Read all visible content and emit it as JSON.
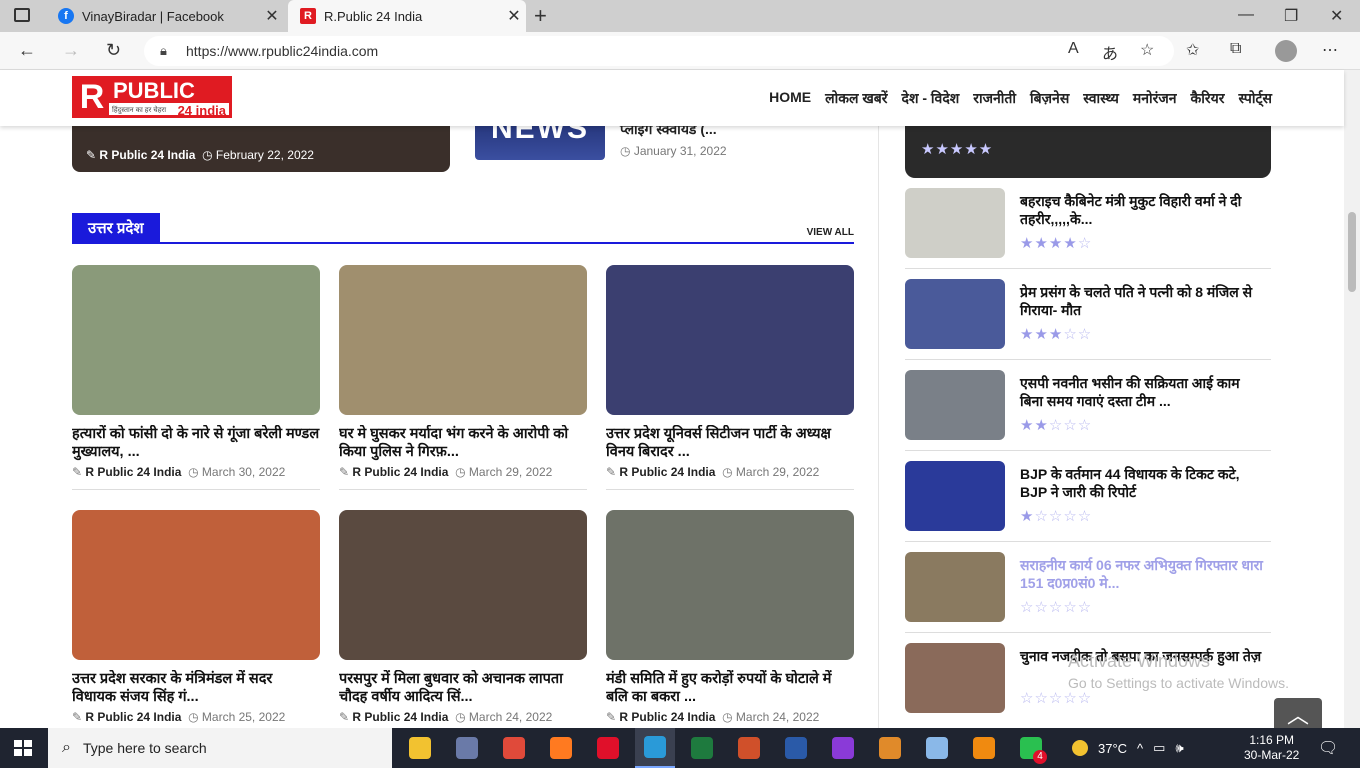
{
  "browser": {
    "tabs": [
      {
        "title": "VinayBiradar | Facebook",
        "icon": "facebook-icon",
        "color": "#1877f2"
      },
      {
        "title": "R.Public 24 India",
        "icon": "rpublic-icon",
        "color": "#e01b22"
      }
    ],
    "url": "https://www.rpublic24india.com"
  },
  "site": {
    "logo": {
      "letter": "R",
      "word": "PUBLIC",
      "tagline": "हिंदुस्तान का हर चेहरा",
      "suffix": "24 india"
    },
    "menu": [
      "HOME",
      "लोकल खबरें",
      "देश - विदेश",
      "राजनीती",
      "बिज़नेस",
      "स्वास्थ्य",
      "मनोरंजन",
      "कैरियर",
      "स्पोर्ट्स"
    ]
  },
  "top_row": {
    "left_author": "R Public 24 India",
    "left_date": "February 22, 2022",
    "thumb_text": "NEWS",
    "right_title": "प्लाइंग स्क्वायड (...",
    "right_date": "January 31, 2022"
  },
  "section": {
    "label": "उत्तर प्रदेश",
    "view_all": "VIEW ALL"
  },
  "cards": [
    {
      "title": "हत्यारों को फांसी दो के नारे से गूंजा बरेली मण्डल मुख्यालय, ...",
      "author": "R Public 24 India",
      "date": "March 30, 2022",
      "color": "#8a9a7a"
    },
    {
      "title": "घर मे घुसकर मर्यादा भंग करने के आरोपी को किया पुलिस ने गिरफ़...",
      "author": "R Public 24 India",
      "date": "March 29, 2022",
      "color": "#a08f6e"
    },
    {
      "title": "उत्तर प्रदेश यूनिवर्स सिटीजन पार्टी के अध्यक्ष विनय बिरादर ...",
      "author": "R Public 24 India",
      "date": "March 29, 2022",
      "color": "#3b3f70"
    },
    {
      "title": "उत्तर प्रदेश सरकार के मंत्रिमंडल में सदर विधायक संजय सिंह गं...",
      "author": "R Public 24 India",
      "date": "March 25, 2022",
      "color": "#c0603a"
    },
    {
      "title": "परसपुर में मिला बुधवार को अचानक लापता चौदह वर्षीय आदित्य सिं...",
      "author": "R Public 24 India",
      "date": "March 24, 2022",
      "color": "#5a4a40"
    },
    {
      "title": "मंडी समिति में हुए करोड़ों रुपयों के घोटाले में बलि का बकरा ...",
      "author": "R Public 24 India",
      "date": "March 24, 2022",
      "color": "#6e7268"
    }
  ],
  "featured": {
    "rating": 5,
    "color": "#2a2a2a"
  },
  "sidebar": [
    {
      "title": "बहराइच कैबिनेट मंत्री मुकुट विहारी वर्मा ने दी तहरीर,,,,,के...",
      "rating": 4,
      "color": "#cfcfc8",
      "faded": false
    },
    {
      "title": "प्रेम प्रसंग के चलते पति ने पत्नी को 8 मंजिल से गिराया- मौत",
      "rating": 3,
      "color": "#4a5a9a",
      "faded": false
    },
    {
      "title": "एसपी नवनीत भसीन की सक्रियता आई काम बिना समय गवाएं दस्ता टीम ...",
      "rating": 2,
      "color": "#7a8088",
      "faded": false
    },
    {
      "title": "BJP के वर्तमान 44 विधायक के टिकट कटे, BJP ने जारी की रिपोर्ट",
      "rating": 1,
      "color": "#2a3a9a",
      "faded": false
    },
    {
      "title": "सराहनीय कार्य 06 नफर अभियुक्त गिरफ्तार धारा 151 द0प्र0सं0 मे...",
      "rating": 0,
      "color": "#8a7a60",
      "faded": true
    },
    {
      "title": "चुनाव नजदीक तो बसपा का जनसम्पर्क हुआ तेज़",
      "rating": 0,
      "color": "#8a6a5a",
      "faded": false
    }
  ],
  "overlay": {
    "activate_title": "Activate Windows",
    "activate_sub": "Go to Settings to activate Windows."
  },
  "taskbar": {
    "search_placeholder": "Type here to search",
    "weather": "37°C",
    "time": "1:16 PM",
    "date": "30-Mar-22",
    "apps": [
      {
        "name": "file-explorer-icon",
        "color": "#f2c230"
      },
      {
        "name": "media-app-icon",
        "color": "#6a7aa8"
      },
      {
        "name": "chrome-icon",
        "color": "#e04a3a"
      },
      {
        "name": "firefox-icon",
        "color": "#ff7a20"
      },
      {
        "name": "opera-icon",
        "color": "#e0102a"
      },
      {
        "name": "edge-icon",
        "color": "#2a9ad8"
      },
      {
        "name": "excel-icon",
        "color": "#1e7a3e"
      },
      {
        "name": "powerpoint-icon",
        "color": "#d0502a"
      },
      {
        "name": "word-icon",
        "color": "#2a5aa8"
      },
      {
        "name": "video-player-icon",
        "color": "#8a3ad8"
      },
      {
        "name": "media-player-icon",
        "color": "#e08a2a"
      },
      {
        "name": "notepad-icon",
        "color": "#8ab8e8"
      },
      {
        "name": "vlc-icon",
        "color": "#f08a10"
      },
      {
        "name": "whatsapp-icon",
        "color": "#2ac050"
      }
    ],
    "whatsapp_badge": "4"
  }
}
